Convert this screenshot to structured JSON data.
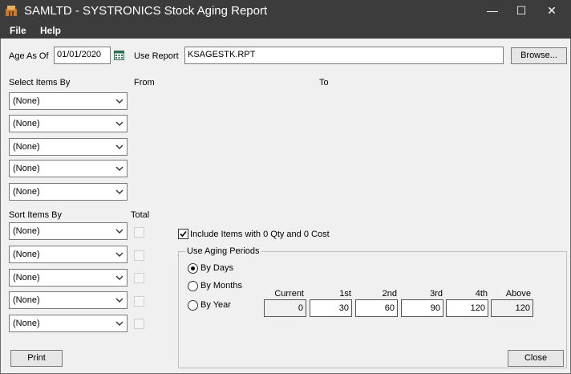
{
  "window": {
    "title": "SAMLTD - SYSTRONICS Stock Aging Report",
    "minimize": "—",
    "maximize": "☐",
    "close": "✕"
  },
  "menu": {
    "file": "File",
    "help": "Help"
  },
  "form": {
    "age_as_of_label": "Age As Of",
    "age_as_of_value": "01/01/2020",
    "use_report_label": "Use Report",
    "use_report_value": "KSAGESTK.RPT",
    "browse_label": "Browse...",
    "select_items_label": "Select Items By",
    "from_label": "From",
    "to_label": "To",
    "select_items": [
      "(None)",
      "(None)",
      "(None)",
      "(None)",
      "(None)"
    ],
    "sort_items_label": "Sort Items By",
    "total_label": "Total",
    "sort_items": [
      "(None)",
      "(None)",
      "(None)",
      "(None)",
      "(None)"
    ],
    "include_zero_label": "Include Items with 0 Qty and 0 Cost",
    "include_zero_checked": true
  },
  "aging": {
    "group_label": "Use Aging Periods",
    "options": [
      "By Days",
      "By Months",
      "By Year"
    ],
    "selected": "By Days",
    "headers": [
      "Current",
      "1st",
      "2nd",
      "3rd",
      "4th",
      "Above"
    ],
    "values": [
      "0",
      "30",
      "60",
      "90",
      "120",
      "120"
    ]
  },
  "buttons": {
    "print": "Print",
    "close": "Close"
  }
}
